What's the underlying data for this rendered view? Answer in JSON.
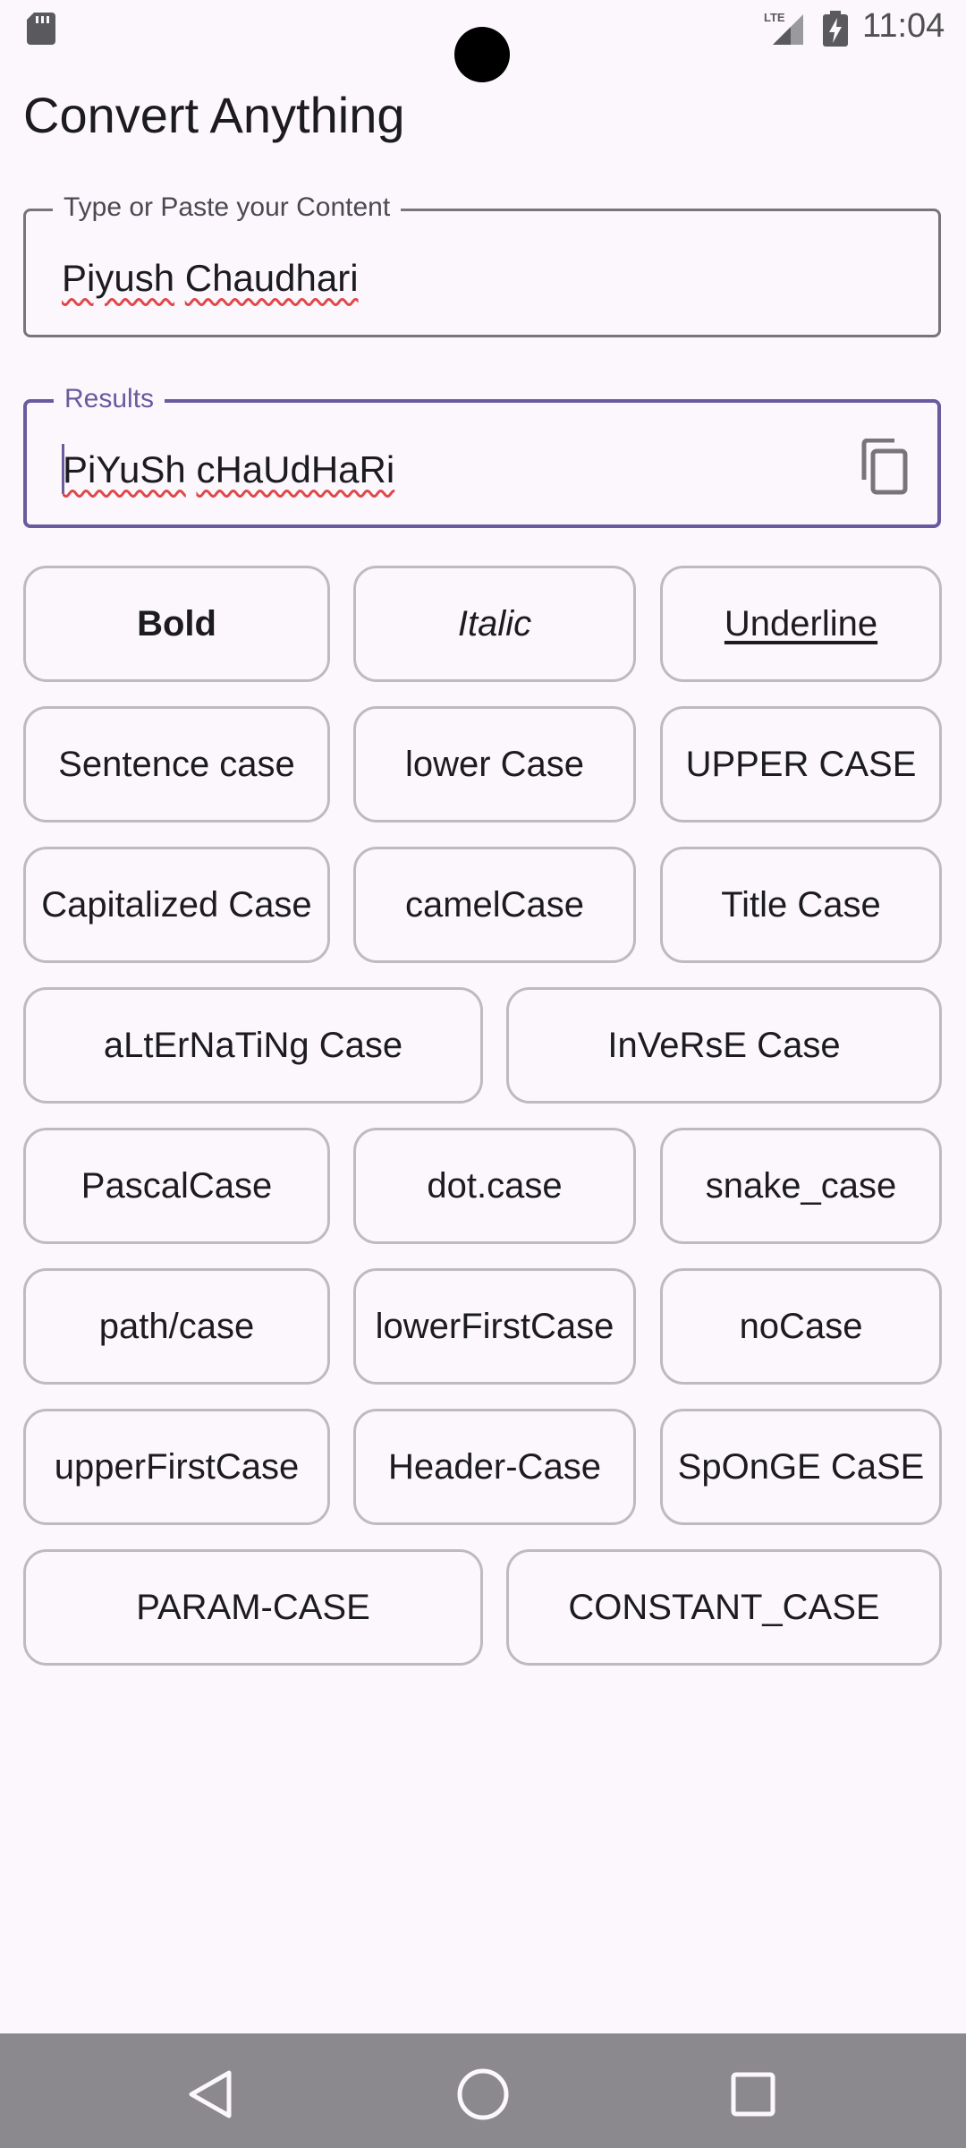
{
  "status_bar": {
    "time": "11:04",
    "network": "LTE",
    "icons": [
      "sd-card-icon",
      "signal-icon",
      "battery-charging-icon"
    ]
  },
  "app": {
    "title": "Convert Anything"
  },
  "input_field": {
    "label": "Type or Paste your Content",
    "words": [
      "Piyush",
      "Chaudhari"
    ]
  },
  "result_field": {
    "label": "Results",
    "words": [
      "PiYuSh",
      "cHaUdHaRi"
    ],
    "accent_color": "#6a5a9e",
    "copy_icon": "copy-icon"
  },
  "buttons": [
    "Bold",
    "Italic",
    "Underline",
    "Sentence case",
    "lower Case",
    "UPPER CASE",
    "Capitalized Case",
    "camelCase",
    "Title Case",
    "aLtErNaTiNg Case",
    "InVeRsE Case",
    "PascalCase",
    "dot.case",
    "snake_case",
    "path/case",
    "lowerFirstCase",
    "noCase",
    "upperFirstCase",
    "Header-Case",
    "SpOnGE CaSE",
    "PARAM-CASE",
    "CONSTANT_CASE"
  ],
  "nav_bar": {
    "icons": [
      "back-icon",
      "home-icon",
      "recents-icon"
    ]
  }
}
